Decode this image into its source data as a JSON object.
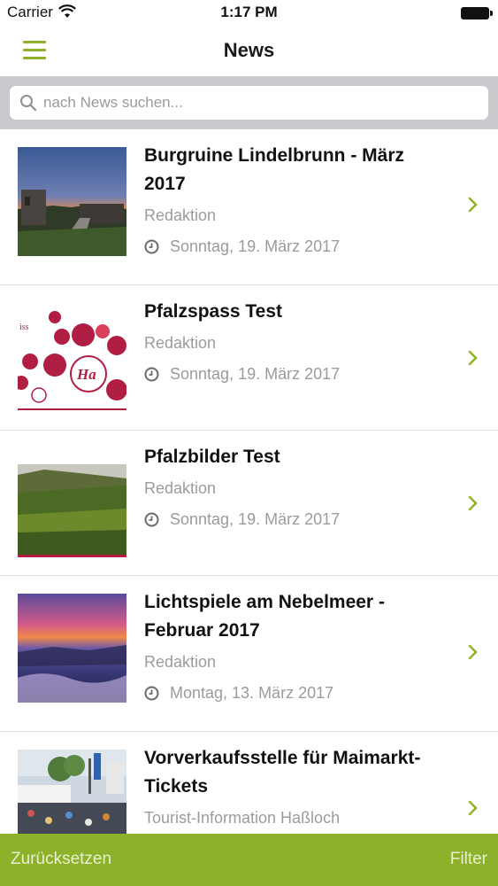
{
  "status_bar": {
    "carrier": "Carrier",
    "time": "1:17 PM"
  },
  "nav": {
    "title": "News",
    "menu_icon": "hamburger-menu-icon"
  },
  "search": {
    "placeholder": "nach News suchen...",
    "value": ""
  },
  "news": [
    {
      "title": "Burgruine Lindelbrunn - März 2017",
      "author": "Redaktion",
      "date": "Sonntag, 19. März 2017",
      "image": "castle-ruin-sunset-photo"
    },
    {
      "title": "Pfalzspass Test",
      "author": "Redaktion",
      "date": "Sonntag, 19. März 2017",
      "image": "speech-bubbles-ha-ho-hi-graphic"
    },
    {
      "title": "Pfalzbilder Test",
      "author": "Redaktion",
      "date": "Sonntag, 19. März 2017",
      "image": "vineyard-hills-photo"
    },
    {
      "title": "Lichtspiele am Nebelmeer - Februar 2017",
      "author": "Redaktion",
      "date": "Montag, 13. März 2017",
      "image": "sea-of-fog-sunset-photo"
    },
    {
      "title": "Vorverkaufsstelle für Maimarkt-Tickets",
      "author": "Tourist-Information Haßloch",
      "date": "",
      "image": "fair-crowd-photo"
    }
  ],
  "bottom_bar": {
    "reset_label": "Zurücksetzen",
    "filter_label": "Filter"
  },
  "colors": {
    "accent": "#8db12a",
    "secondary_text": "#9b9b9b",
    "search_background": "#c9c9ce"
  }
}
